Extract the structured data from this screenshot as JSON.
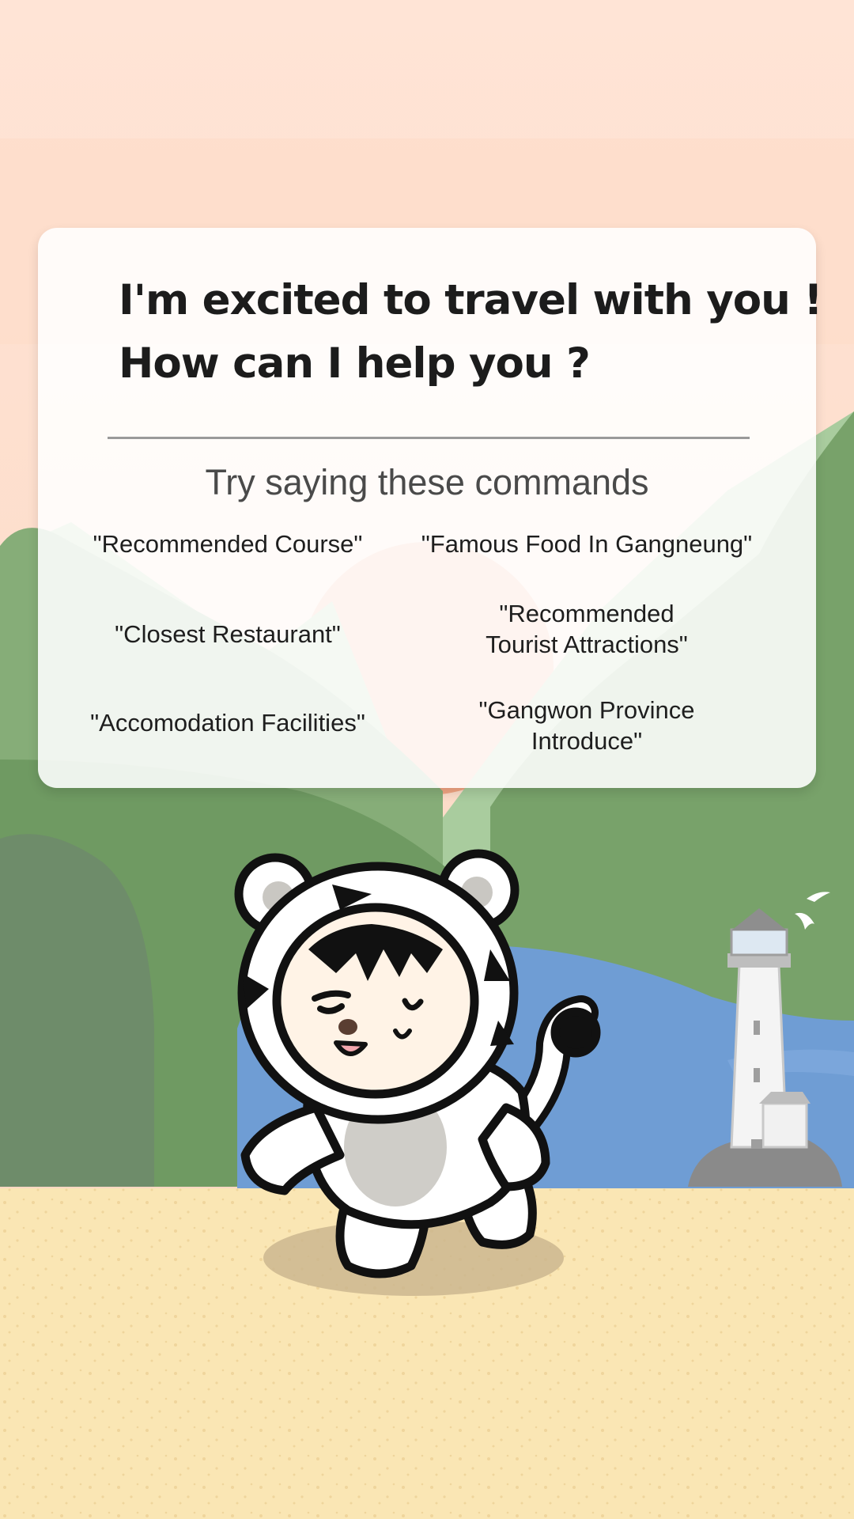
{
  "greeting": {
    "line1": "I'm excited to travel with you !",
    "line2": "How can I help you ?"
  },
  "hint_title": "Try saying these commands",
  "commands": [
    {
      "lines": [
        "\"Recommended Course\""
      ]
    },
    {
      "lines": [
        "\"Famous Food In Gangneung\""
      ]
    },
    {
      "lines": [
        "\"Closest Restaurant\""
      ]
    },
    {
      "lines": [
        "\"Recommended",
        "Tourist Attractions\""
      ]
    },
    {
      "lines": [
        "\"Accomodation Facilities\""
      ]
    },
    {
      "lines": [
        "\"Gangwon Province",
        "Introduce\""
      ]
    }
  ],
  "colors": {
    "sky_top": "#FFE4D6",
    "sky_bottom": "#FBD9C3",
    "hill_light": "#8EB57F",
    "hill_mid": "#78A26A",
    "hill_dark": "#6E8C6A",
    "sea": "#6F9DD4",
    "sand": "#FAE6B4"
  },
  "illustration": {
    "character": "tiger-costume-mascot",
    "landmark": "lighthouse-icon",
    "birds": "seagull-icon"
  }
}
